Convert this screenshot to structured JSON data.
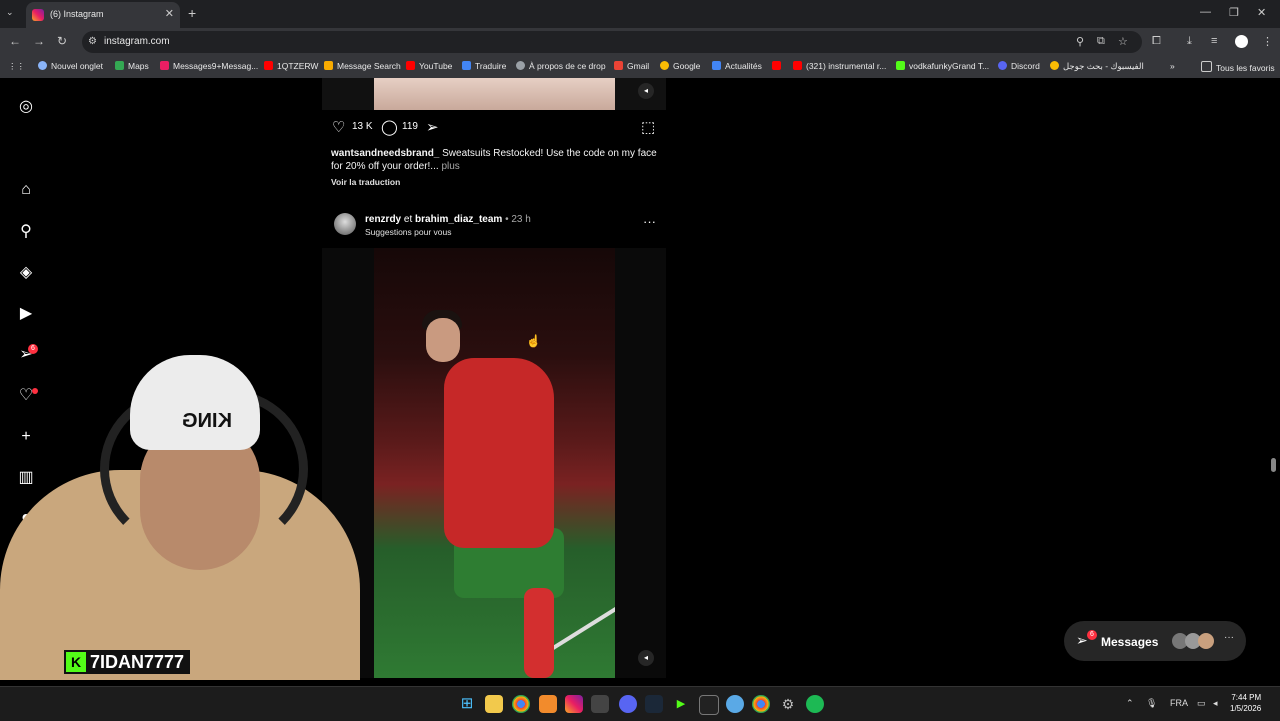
{
  "browser": {
    "tab_title": "(6) Instagram",
    "url": "instagram.com",
    "bookmarks": [
      "Nouvel onglet",
      "Maps",
      "Messages9+Messag...",
      "1QTZERW",
      "Message Search",
      "YouTube",
      "Traduire",
      "À propos de ce drop",
      "Gmail",
      "Google",
      "Actualités",
      "(321) instrumental r...",
      "vodkafunkyGrand T...",
      "Discord",
      "الفيسبوك - بحث جوجل",
      "Tous les favoris"
    ]
  },
  "sidebar": {
    "icons": [
      "instagram-icon",
      "home-icon",
      "search-icon",
      "explore-icon",
      "reels-icon",
      "direct-icon",
      "heart-icon",
      "create-icon",
      "dashboard-icon",
      "profile-icon"
    ],
    "direct_badge": "6"
  },
  "post1": {
    "likes": "13 K",
    "comments": "119",
    "username": "wantsandneedsbrand_",
    "caption": "Sweatsuits Restocked! Use the code on my face for 20% off your order!...",
    "more": "plus",
    "translate": "Voir la traduction"
  },
  "post2": {
    "user1": "renzrdy",
    "and": "et",
    "user2": "brahim_diaz_team",
    "time": "• 23 h",
    "subtitle": "Suggestions pour vous"
  },
  "messages": {
    "label": "Messages",
    "badge": "6"
  },
  "streamer": {
    "beanie_text": "KING",
    "name": "7IDAN7777",
    "logo": "K"
  },
  "taskbar": {
    "lang": "FRA",
    "time": "7:44 PM",
    "date": "1/5/2026"
  }
}
